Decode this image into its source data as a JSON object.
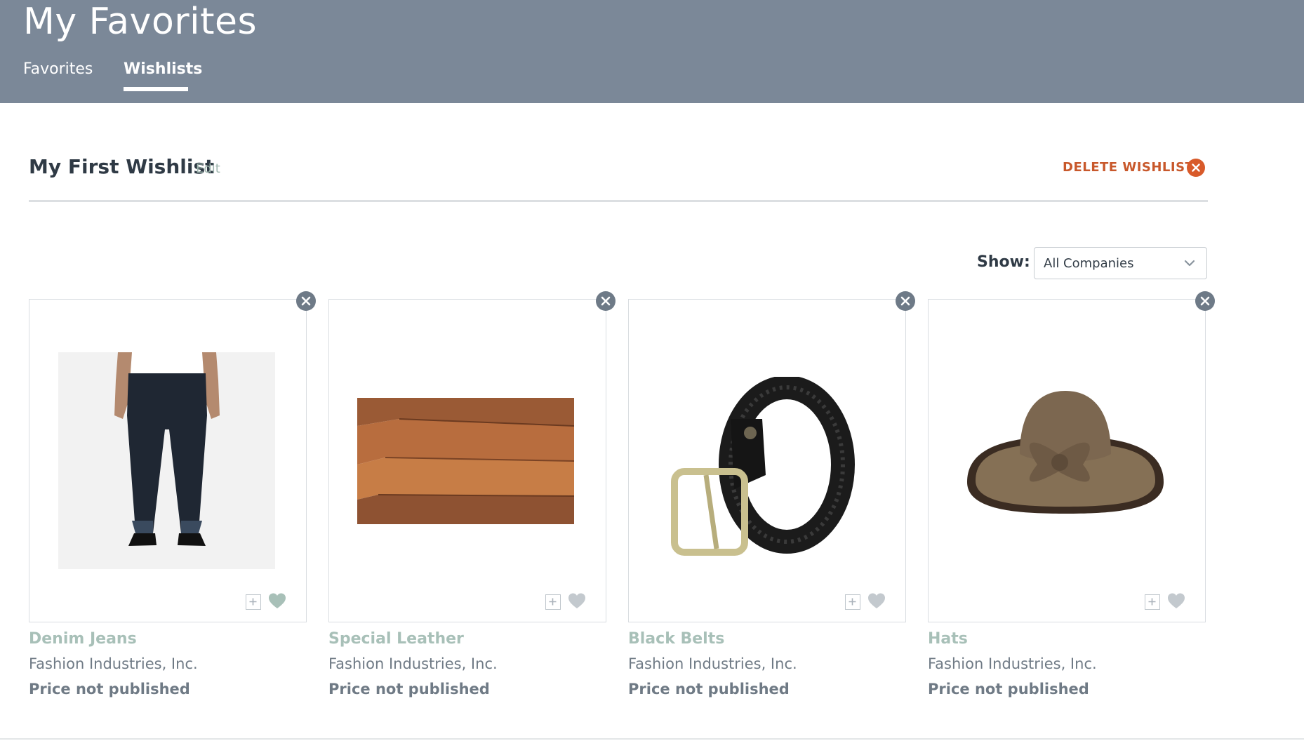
{
  "header": {
    "title": "My Favorites",
    "tabs": [
      {
        "label": "Favorites",
        "active": false
      },
      {
        "label": "Wishlists",
        "active": true
      }
    ]
  },
  "wishlist": {
    "name": "My First Wishlist",
    "edit_label": "Edit",
    "delete_label": "DELETE WISHLIST"
  },
  "filter": {
    "label": "Show:",
    "selected": "All Companies"
  },
  "products": [
    {
      "name": "Denim Jeans",
      "company": "Fashion Industries, Inc.",
      "price": "Price not published",
      "image": "jeans"
    },
    {
      "name": "Special Leather",
      "company": "Fashion Industries, Inc.",
      "price": "Price not published",
      "image": "leather"
    },
    {
      "name": "Black Belts",
      "company": "Fashion Industries, Inc.",
      "price": "Price not published",
      "image": "belt"
    },
    {
      "name": "Hats",
      "company": "Fashion Industries, Inc.",
      "price": "Price not published",
      "image": "hat"
    }
  ],
  "colors": {
    "header_bg": "#7b8898",
    "accent_delete": "#d85a2a",
    "product_name": "#a8c0b8",
    "heart": "#a8c0b8"
  }
}
